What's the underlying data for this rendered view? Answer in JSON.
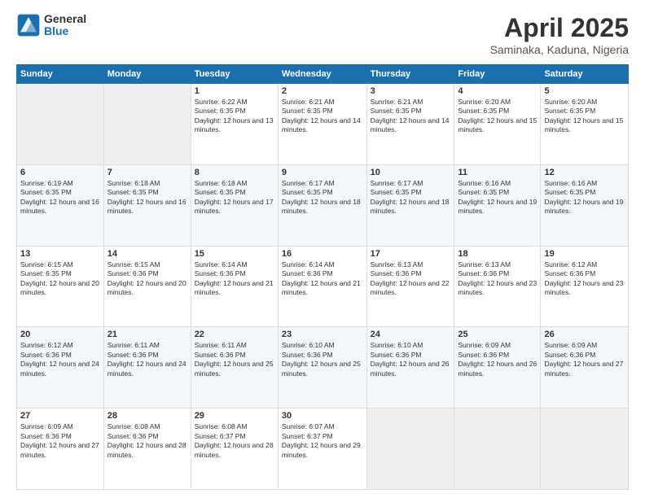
{
  "header": {
    "logo_general": "General",
    "logo_blue": "Blue",
    "title": "April 2025",
    "location": "Saminaka, Kaduna, Nigeria"
  },
  "weekdays": [
    "Sunday",
    "Monday",
    "Tuesday",
    "Wednesday",
    "Thursday",
    "Friday",
    "Saturday"
  ],
  "weeks": [
    [
      {
        "day": "",
        "info": ""
      },
      {
        "day": "",
        "info": ""
      },
      {
        "day": "1",
        "info": "Sunrise: 6:22 AM\nSunset: 6:35 PM\nDaylight: 12 hours and 13 minutes."
      },
      {
        "day": "2",
        "info": "Sunrise: 6:21 AM\nSunset: 6:35 PM\nDaylight: 12 hours and 14 minutes."
      },
      {
        "day": "3",
        "info": "Sunrise: 6:21 AM\nSunset: 6:35 PM\nDaylight: 12 hours and 14 minutes."
      },
      {
        "day": "4",
        "info": "Sunrise: 6:20 AM\nSunset: 6:35 PM\nDaylight: 12 hours and 15 minutes."
      },
      {
        "day": "5",
        "info": "Sunrise: 6:20 AM\nSunset: 6:35 PM\nDaylight: 12 hours and 15 minutes."
      }
    ],
    [
      {
        "day": "6",
        "info": "Sunrise: 6:19 AM\nSunset: 6:35 PM\nDaylight: 12 hours and 16 minutes."
      },
      {
        "day": "7",
        "info": "Sunrise: 6:18 AM\nSunset: 6:35 PM\nDaylight: 12 hours and 16 minutes."
      },
      {
        "day": "8",
        "info": "Sunrise: 6:18 AM\nSunset: 6:35 PM\nDaylight: 12 hours and 17 minutes."
      },
      {
        "day": "9",
        "info": "Sunrise: 6:17 AM\nSunset: 6:35 PM\nDaylight: 12 hours and 18 minutes."
      },
      {
        "day": "10",
        "info": "Sunrise: 6:17 AM\nSunset: 6:35 PM\nDaylight: 12 hours and 18 minutes."
      },
      {
        "day": "11",
        "info": "Sunrise: 6:16 AM\nSunset: 6:35 PM\nDaylight: 12 hours and 19 minutes."
      },
      {
        "day": "12",
        "info": "Sunrise: 6:16 AM\nSunset: 6:35 PM\nDaylight: 12 hours and 19 minutes."
      }
    ],
    [
      {
        "day": "13",
        "info": "Sunrise: 6:15 AM\nSunset: 6:35 PM\nDaylight: 12 hours and 20 minutes."
      },
      {
        "day": "14",
        "info": "Sunrise: 6:15 AM\nSunset: 6:36 PM\nDaylight: 12 hours and 20 minutes."
      },
      {
        "day": "15",
        "info": "Sunrise: 6:14 AM\nSunset: 6:36 PM\nDaylight: 12 hours and 21 minutes."
      },
      {
        "day": "16",
        "info": "Sunrise: 6:14 AM\nSunset: 6:36 PM\nDaylight: 12 hours and 21 minutes."
      },
      {
        "day": "17",
        "info": "Sunrise: 6:13 AM\nSunset: 6:36 PM\nDaylight: 12 hours and 22 minutes."
      },
      {
        "day": "18",
        "info": "Sunrise: 6:13 AM\nSunset: 6:36 PM\nDaylight: 12 hours and 23 minutes."
      },
      {
        "day": "19",
        "info": "Sunrise: 6:12 AM\nSunset: 6:36 PM\nDaylight: 12 hours and 23 minutes."
      }
    ],
    [
      {
        "day": "20",
        "info": "Sunrise: 6:12 AM\nSunset: 6:36 PM\nDaylight: 12 hours and 24 minutes."
      },
      {
        "day": "21",
        "info": "Sunrise: 6:11 AM\nSunset: 6:36 PM\nDaylight: 12 hours and 24 minutes."
      },
      {
        "day": "22",
        "info": "Sunrise: 6:11 AM\nSunset: 6:36 PM\nDaylight: 12 hours and 25 minutes."
      },
      {
        "day": "23",
        "info": "Sunrise: 6:10 AM\nSunset: 6:36 PM\nDaylight: 12 hours and 25 minutes."
      },
      {
        "day": "24",
        "info": "Sunrise: 6:10 AM\nSunset: 6:36 PM\nDaylight: 12 hours and 26 minutes."
      },
      {
        "day": "25",
        "info": "Sunrise: 6:09 AM\nSunset: 6:36 PM\nDaylight: 12 hours and 26 minutes."
      },
      {
        "day": "26",
        "info": "Sunrise: 6:09 AM\nSunset: 6:36 PM\nDaylight: 12 hours and 27 minutes."
      }
    ],
    [
      {
        "day": "27",
        "info": "Sunrise: 6:09 AM\nSunset: 6:36 PM\nDaylight: 12 hours and 27 minutes."
      },
      {
        "day": "28",
        "info": "Sunrise: 6:08 AM\nSunset: 6:36 PM\nDaylight: 12 hours and 28 minutes."
      },
      {
        "day": "29",
        "info": "Sunrise: 6:08 AM\nSunset: 6:37 PM\nDaylight: 12 hours and 28 minutes."
      },
      {
        "day": "30",
        "info": "Sunrise: 6:07 AM\nSunset: 6:37 PM\nDaylight: 12 hours and 29 minutes."
      },
      {
        "day": "",
        "info": ""
      },
      {
        "day": "",
        "info": ""
      },
      {
        "day": "",
        "info": ""
      }
    ]
  ]
}
